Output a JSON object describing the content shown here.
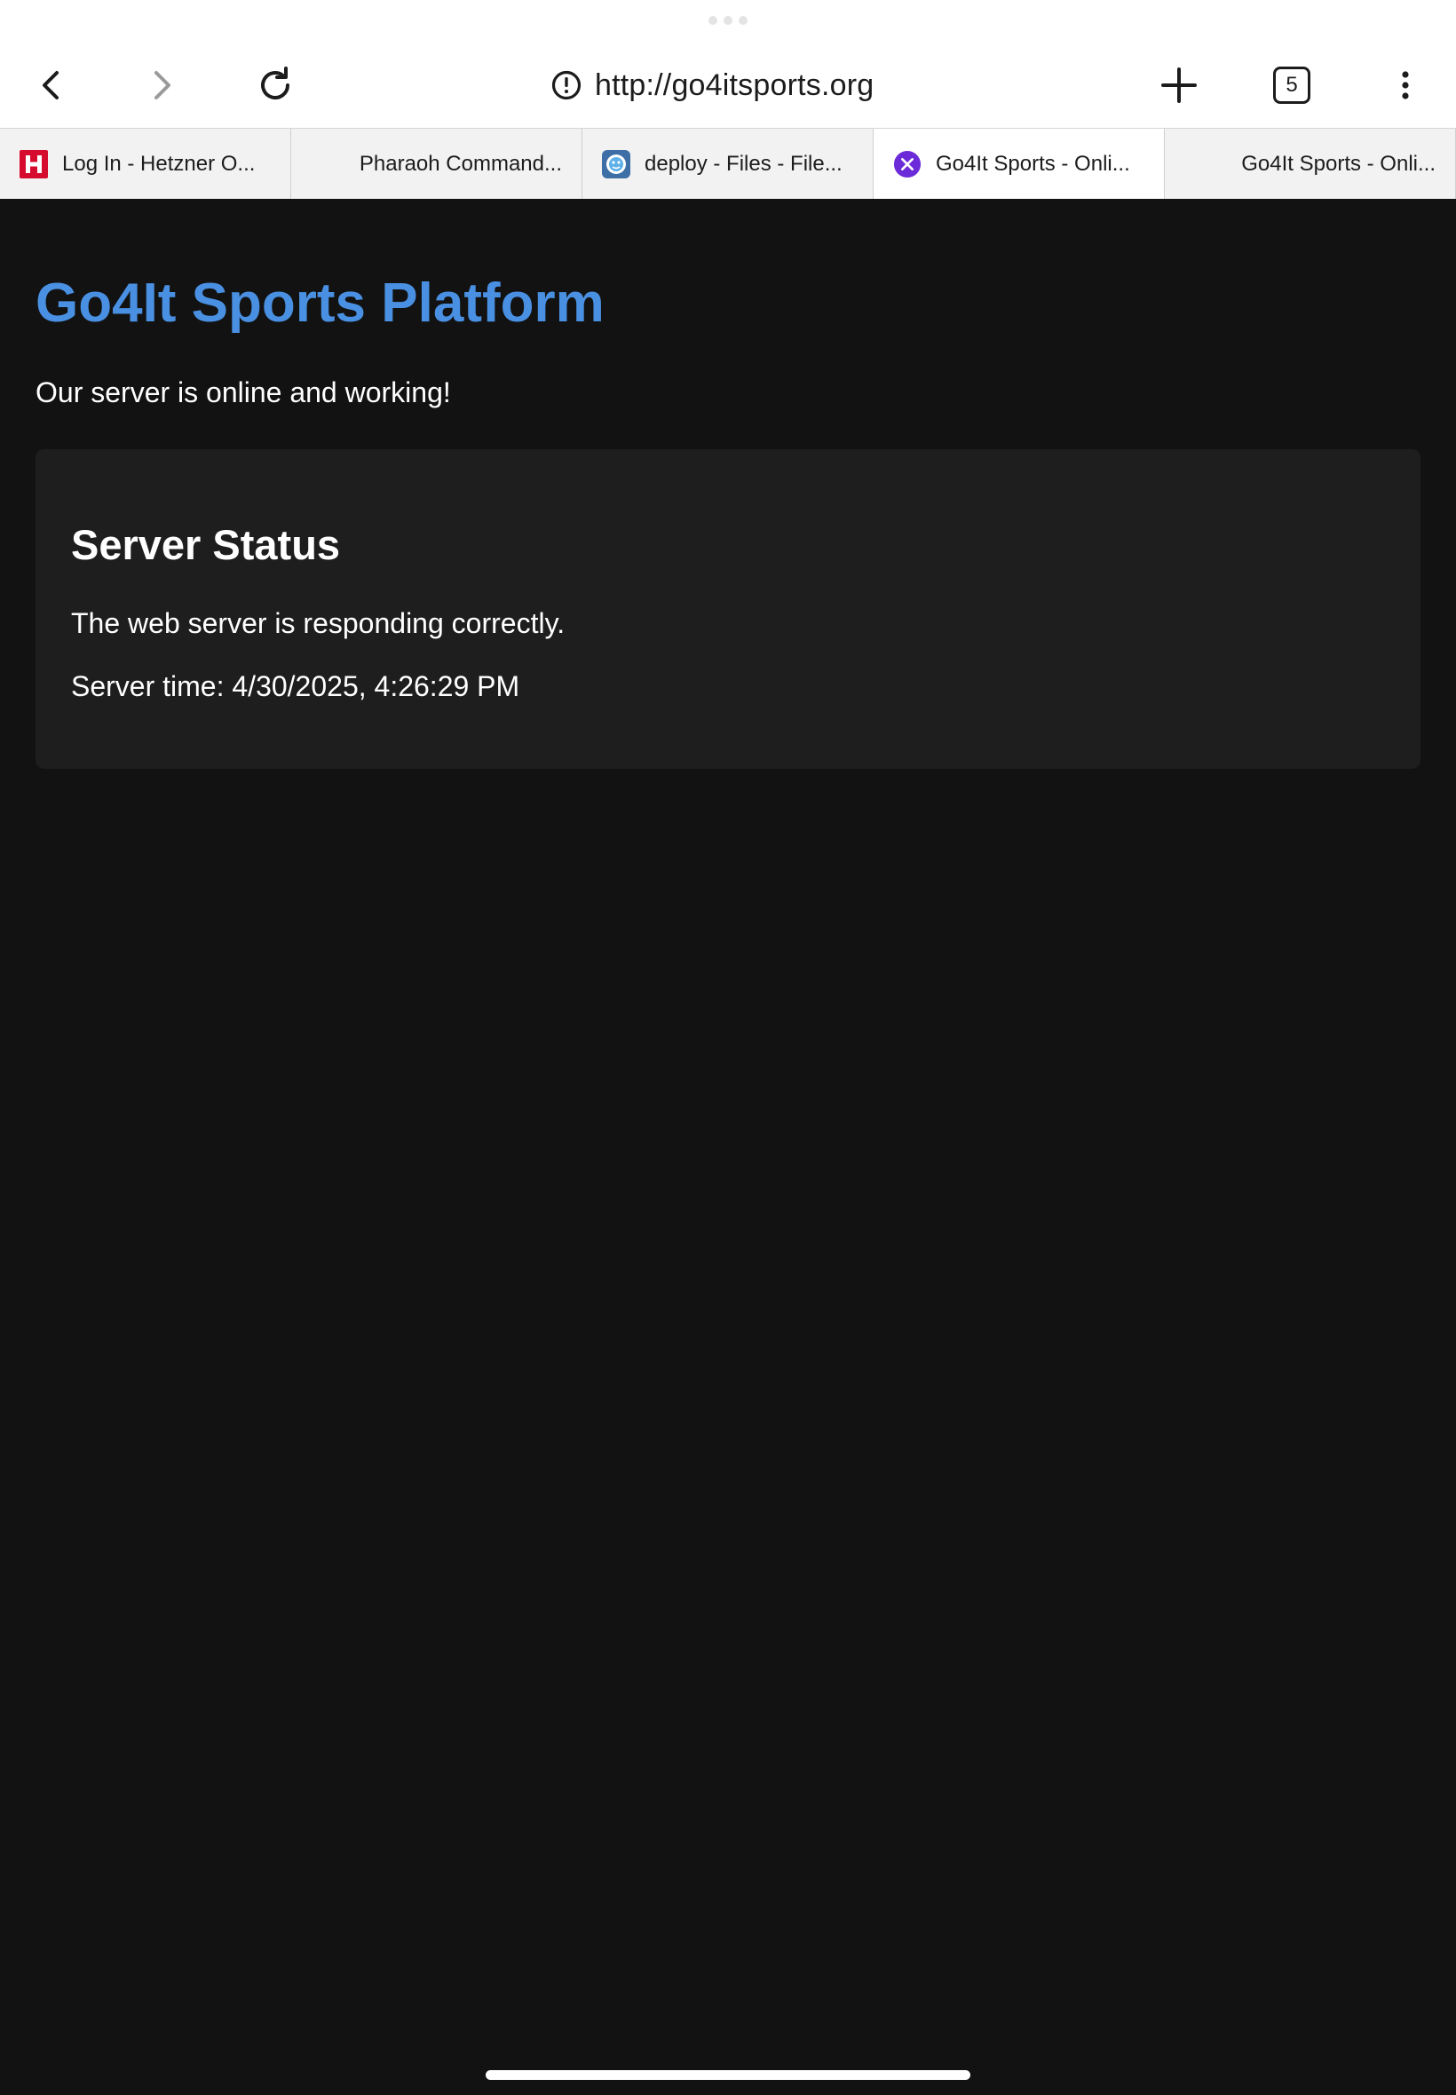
{
  "browser": {
    "url": "http://go4itsports.org",
    "tab_count": "5",
    "icons": {
      "back": "chevron-left-icon",
      "forward": "chevron-right-icon",
      "reload": "reload-icon",
      "site_info": "info-alert-icon",
      "new_tab": "plus-icon",
      "tab_switcher": "tab-count-icon",
      "menu": "more-vertical-icon"
    },
    "tabs": [
      {
        "title": "Log In - Hetzner O...",
        "favicon": "hetzner-icon",
        "active": false
      },
      {
        "title": "Pharaoh Command...",
        "favicon": "",
        "active": false
      },
      {
        "title": "deploy - Files - File...",
        "favicon": "filebrowser-icon",
        "active": false
      },
      {
        "title": "Go4It Sports - Onli...",
        "favicon": "close-tab-icon",
        "active": true
      },
      {
        "title": "Go4It Sports - Onli...",
        "favicon": "",
        "active": false
      }
    ]
  },
  "page": {
    "title": "Go4It Sports Platform",
    "subtitle": "Our server is online and working!",
    "status_card": {
      "heading": "Server Status",
      "message": "The web server is responding correctly.",
      "time": "Server time: 4/30/2025, 4:26:29 PM"
    }
  },
  "colors": {
    "page_background": "#121212",
    "card_background": "#1e1e1e",
    "title_accent": "#4a90e2",
    "active_tab_icon": "#6c2bd9",
    "hetzner_red": "#d50c2d"
  }
}
